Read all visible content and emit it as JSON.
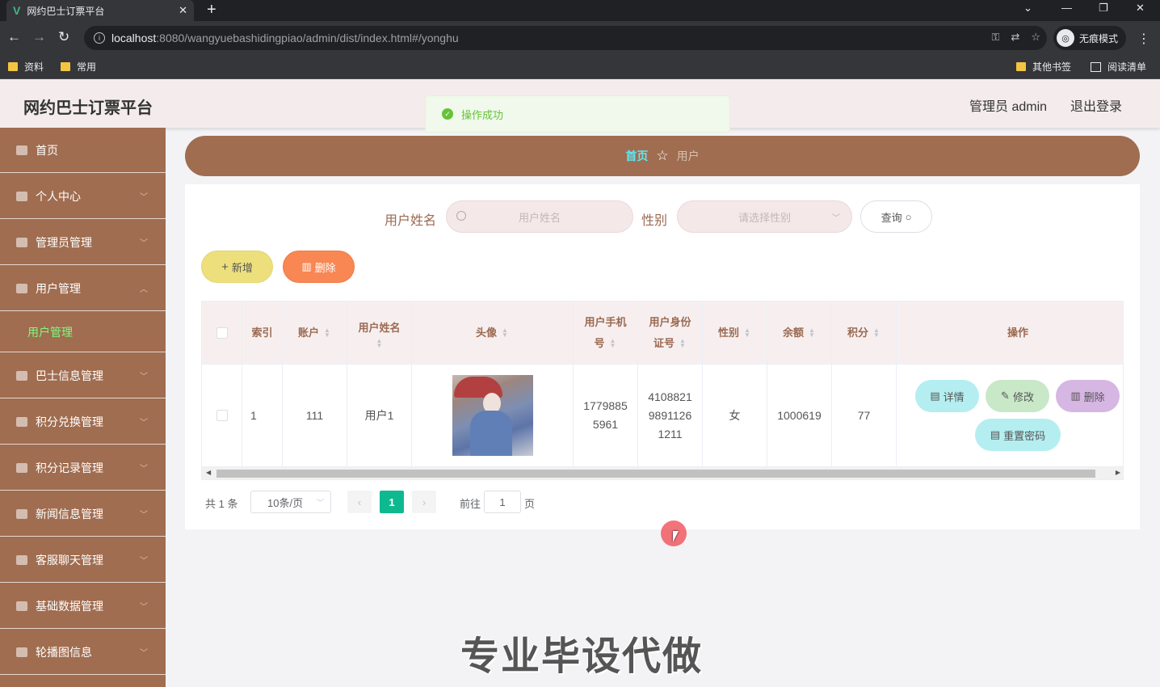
{
  "browser": {
    "tab_title": "网约巴士订票平台",
    "url_host": "localhost",
    "url_path": ":8080/wangyuebashidingpiao/admin/dist/index.html#/yonghu",
    "incognito_label": "无痕模式",
    "bookmarks": [
      "资料",
      "常用"
    ],
    "other_bookmarks": "其他书签",
    "reading_list": "阅读清单"
  },
  "header": {
    "title": "网约巴士订票平台",
    "admin_label": "管理员 admin",
    "logout": "退出登录"
  },
  "toast": {
    "message": "操作成功"
  },
  "sidebar": {
    "items": [
      "首页",
      "个人中心",
      "管理员管理",
      "用户管理",
      "巴士信息管理",
      "积分兑换管理",
      "积分记录管理",
      "新闻信息管理",
      "客服聊天管理",
      "基础数据管理",
      "轮播图信息"
    ],
    "active_sub": "用户管理"
  },
  "breadcrumb": {
    "home": "首页",
    "current": "用户"
  },
  "search": {
    "name_label": "用户姓名",
    "name_placeholder": "用户姓名",
    "gender_label": "性别",
    "gender_placeholder": "请选择性别",
    "query_label": "查询"
  },
  "actions": {
    "add": "新增",
    "delete": "删除"
  },
  "table": {
    "headers": {
      "index": "索引",
      "account": "账户",
      "name": "用户姓名",
      "avatar": "头像",
      "phone_1": "用户手机",
      "phone_2": "号",
      "idcard_1": "用户身份",
      "idcard_2": "证号",
      "gender": "性别",
      "balance": "余额",
      "points": "积分",
      "ops": "操作"
    },
    "rows": [
      {
        "index": "1",
        "account": "111",
        "name": "用户1",
        "phone_1": "1779885",
        "phone_2": "5961",
        "idcard_1": "4108821",
        "idcard_2": "9891126",
        "idcard_3": "1211",
        "gender": "女",
        "balance": "1000619",
        "points": "77"
      }
    ],
    "row_ops": {
      "detail": "详情",
      "edit": "修改",
      "delete": "删除",
      "reset": "重置密码"
    }
  },
  "pagination": {
    "total": "共 1 条",
    "page_size": "10条/页",
    "current": "1",
    "goto_label": "前往",
    "goto_value": "1",
    "page_suffix": "页"
  },
  "watermark": "专业毕设代做",
  "colors": {
    "sidebar": "#a06d50",
    "accent_green": "#0fb990",
    "header_bg": "#f4ecec"
  }
}
